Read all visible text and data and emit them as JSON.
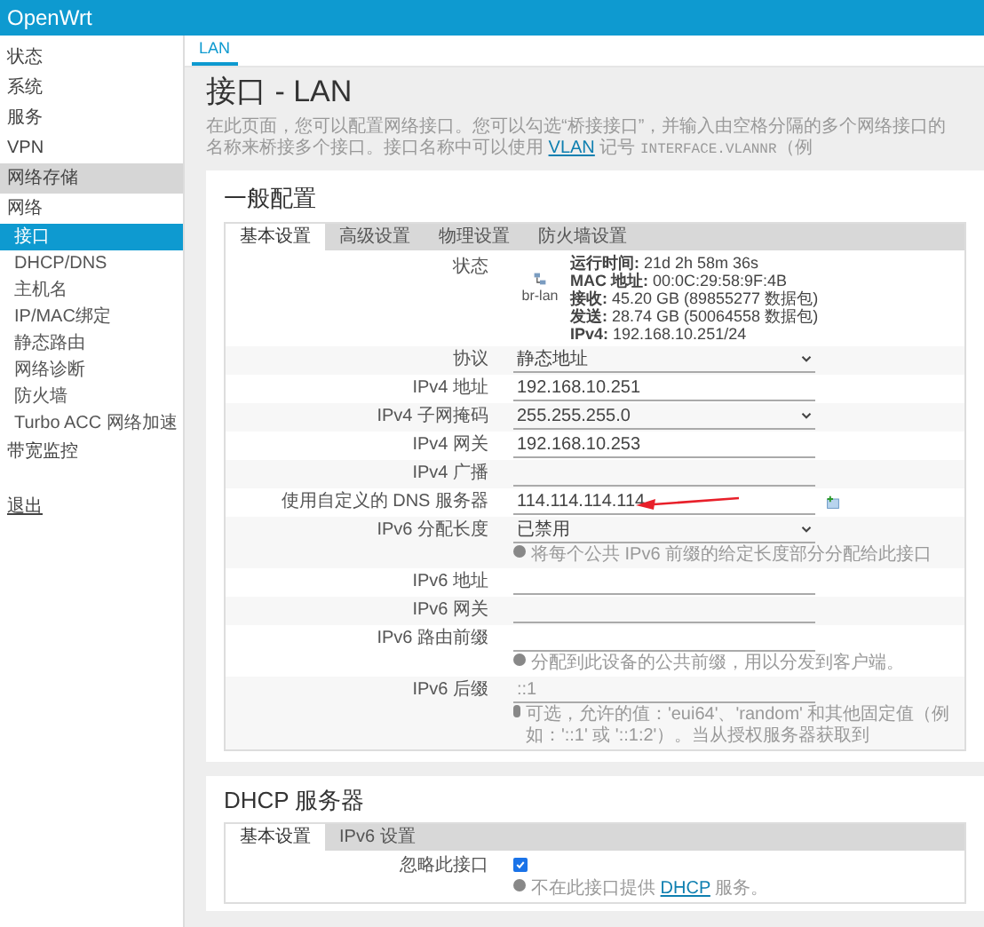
{
  "header": {
    "brand": "OpenWrt"
  },
  "sidebar": {
    "items": [
      {
        "label": "状态",
        "selected": false,
        "highlighted": false
      },
      {
        "label": "系统",
        "selected": false,
        "highlighted": false
      },
      {
        "label": "服务",
        "selected": false,
        "highlighted": false
      },
      {
        "label": "VPN",
        "selected": false,
        "highlighted": false
      },
      {
        "label": "网络存储",
        "selected": false,
        "highlighted": true
      },
      {
        "label": "网络",
        "selected": false,
        "highlighted": false,
        "children": [
          {
            "label": "接口",
            "selected": true
          },
          {
            "label": "DHCP/DNS",
            "selected": false
          },
          {
            "label": "主机名",
            "selected": false
          },
          {
            "label": "IP/MAC绑定",
            "selected": false
          },
          {
            "label": "静态路由",
            "selected": false
          },
          {
            "label": "网络诊断",
            "selected": false
          },
          {
            "label": "防火墙",
            "selected": false
          },
          {
            "label": "Turbo ACC 网络加速",
            "selected": false
          }
        ]
      },
      {
        "label": "带宽监控",
        "selected": false,
        "highlighted": false
      }
    ],
    "logout": "退出"
  },
  "top_tabs": [
    {
      "label": "LAN",
      "selected": true
    }
  ],
  "page": {
    "title": "接口 - LAN",
    "description": [
      {
        "text": "在此页面，您可以配置网络接口。您可以勾选“桥接接口”，并输入由空格分隔的多个网络接口的名称来桥接多个接口。接口名称中可以使用 "
      },
      {
        "text": "VLAN",
        "link": true
      },
      {
        "text": " 记号 "
      },
      {
        "text": "INTERFACE.VLANNR",
        "code": true
      },
      {
        "text": "（例"
      }
    ]
  },
  "general": {
    "title": "一般配置",
    "tabs": [
      {
        "label": "基本设置",
        "selected": true
      },
      {
        "label": "高级设置",
        "selected": false
      },
      {
        "label": "物理设置",
        "selected": false
      },
      {
        "label": "防火墙设置",
        "selected": false
      }
    ],
    "status": {
      "label": "状态",
      "device": "br-lan",
      "lines": [
        "**运行时间:** 21d 2h 58m 36s",
        "**MAC 地址:** 00:0C:29:58:9F:4B",
        "**接收:** 45.20 GB (89855277 数据包)",
        "**发送:** 28.74 GB (50064558 数据包)",
        "**IPv4:** 192.168.10.251/24"
      ]
    },
    "rows": [
      {
        "kind": "select",
        "label": "协议",
        "value": "静态地址"
      },
      {
        "kind": "text",
        "label": "IPv4 地址",
        "value": "192.168.10.251"
      },
      {
        "kind": "select",
        "label": "IPv4 子网掩码",
        "value": "255.255.255.0"
      },
      {
        "kind": "text",
        "label": "IPv4 网关",
        "value": "192.168.10.253"
      },
      {
        "kind": "text",
        "label": "IPv4 广播"
      },
      {
        "kind": "dynlist",
        "label": "使用自定义的 DNS 服务器",
        "value": "114.114.114.114",
        "annotation_arrow": true
      },
      {
        "kind": "select",
        "label": "IPv6 分配长度",
        "value": "已禁用",
        "hint": [
          {
            "text": "将每个公共 IPv6 前缀的给定长度部分分配给此接口"
          }
        ]
      },
      {
        "kind": "text",
        "label": "IPv6 地址"
      },
      {
        "kind": "text",
        "label": "IPv6 网关"
      },
      {
        "kind": "text",
        "label": "IPv6 路由前缀",
        "hint": [
          {
            "text": "分配到此设备的公共前缀，用以分发到客户端。"
          }
        ]
      },
      {
        "kind": "text",
        "label": "IPv6 后缀",
        "placeholder": "::1",
        "hint": [
          {
            "text": "可选，允许的值：'eui64'、'random' 和其他固定值（例如：'::1' 或 '::1:2'）。当从授权服务器获取到"
          }
        ]
      }
    ]
  },
  "dhcp": {
    "title": "DHCP 服务器",
    "tabs": [
      {
        "label": "基本设置",
        "selected": true
      },
      {
        "label": "IPv6 设置",
        "selected": false
      }
    ],
    "rows": [
      {
        "kind": "checkbox",
        "label": "忽略此接口",
        "checked": true,
        "hint": [
          {
            "text": "不在此接口提供 "
          },
          {
            "text": "DHCP",
            "link": true
          },
          {
            "text": " 服务。"
          }
        ]
      }
    ]
  }
}
